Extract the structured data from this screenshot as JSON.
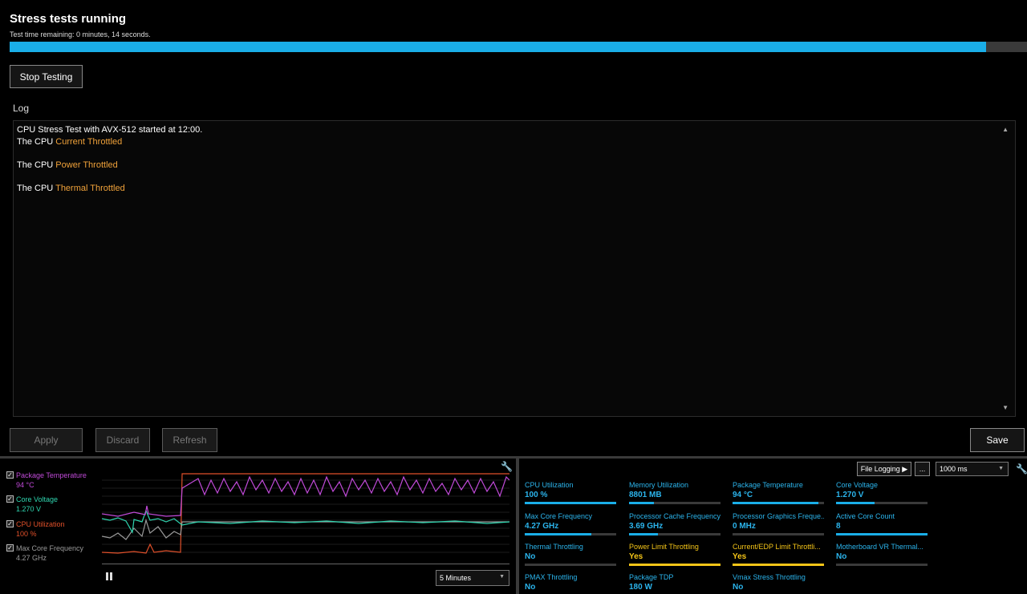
{
  "header": {
    "title": "Stress tests running",
    "time_remaining": "Test time remaining: 0 minutes, 14 seconds.",
    "progress": 0.96
  },
  "buttons": {
    "stop": "Stop Testing",
    "apply": "Apply",
    "discard": "Discard",
    "refresh": "Refresh",
    "save": "Save"
  },
  "log": {
    "label": "Log",
    "lines": [
      {
        "prefix": "CPU Stress Test with AVX-512 started at 12:00.",
        "highlight": ""
      },
      {
        "prefix": "The CPU ",
        "highlight": "Current Throttled"
      },
      {
        "prefix": "The CPU ",
        "highlight": "Power Throttled"
      },
      {
        "prefix": "The CPU ",
        "highlight": "Thermal Throttled"
      }
    ]
  },
  "legend": [
    {
      "name": "Package Temperature",
      "value": "94 °C",
      "color": "#c04ad8",
      "checked": "✓"
    },
    {
      "name": "Core Voltage",
      "value": "1.270 V",
      "color": "#2fd6b0",
      "checked": "✓"
    },
    {
      "name": "CPU Utilization",
      "value": "100 %",
      "color": "#e0502a",
      "checked": "✓"
    },
    {
      "name": "Max Core Frequency",
      "value": "4.27 GHz",
      "color": "#9a9a9a",
      "checked": "✓"
    }
  ],
  "graph": {
    "time_range": "5 Minutes"
  },
  "monitor": {
    "file_logging": "File Logging ▶",
    "more": "...",
    "interval": "1000 ms",
    "metrics": [
      {
        "label": "CPU Utilization",
        "value": "100 %",
        "fill": 1.0,
        "color": "blue"
      },
      {
        "label": "Memory Utilization",
        "value": "8801  MB",
        "fill": 0.27,
        "color": "blue"
      },
      {
        "label": "Package Temperature",
        "value": "94 °C",
        "fill": 0.94,
        "color": "blue"
      },
      {
        "label": "Core Voltage",
        "value": "1.270 V",
        "fill": 0.42,
        "color": "blue"
      },
      {
        "label": "Max Core Frequency",
        "value": "4.27 GHz",
        "fill": 0.73,
        "color": "blue"
      },
      {
        "label": "Processor Cache Frequency",
        "value": "3.69 GHz",
        "fill": 0.32,
        "color": "blue"
      },
      {
        "label": "Processor Graphics Freque...",
        "value": "0 MHz",
        "fill": 0.0,
        "color": "blue"
      },
      {
        "label": "Active Core Count",
        "value": "8",
        "fill": 1.0,
        "color": "blue"
      },
      {
        "label": "Thermal Throttling",
        "value": "No",
        "fill": 0.0,
        "color": "blue"
      },
      {
        "label": "Power Limit Throttling",
        "value": "Yes",
        "fill": 1.0,
        "color": "yellow"
      },
      {
        "label": "Current/EDP Limit Throttli...",
        "value": "Yes",
        "fill": 1.0,
        "color": "yellow"
      },
      {
        "label": "Motherboard VR Thermal...",
        "value": "No",
        "fill": 0.0,
        "color": "blue"
      },
      {
        "label": "PMAX Throttling",
        "value": "No",
        "fill": 0.0,
        "color": "blue"
      },
      {
        "label": "Package TDP",
        "value": "180 W",
        "fill": 0.0,
        "color": "blue"
      },
      {
        "label": "Vmax Stress Throttling",
        "value": "No",
        "fill": 0.0,
        "color": "blue"
      }
    ]
  }
}
